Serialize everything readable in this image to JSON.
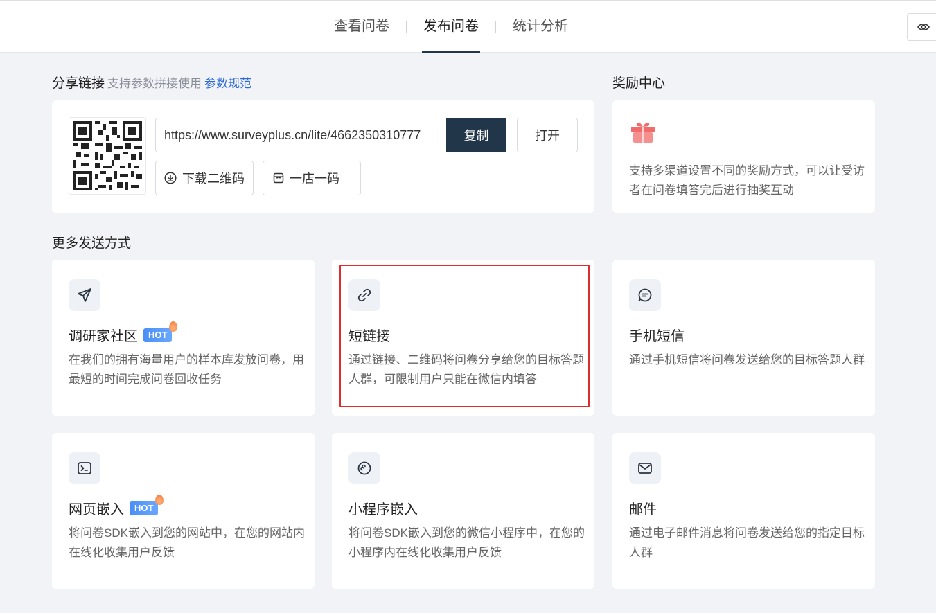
{
  "tabs": [
    {
      "label": "查看问卷",
      "active": false
    },
    {
      "label": "发布问卷",
      "active": true
    },
    {
      "label": "统计分析",
      "active": false
    }
  ],
  "share": {
    "title": "分享链接",
    "hint": "支持参数拼接使用",
    "spec_link": "参数规范",
    "url": "https://www.surveyplus.cn/lite/4662350310777",
    "copy_label": "复制",
    "open_label": "打开",
    "download_qr_label": "下载二维码",
    "store_code_label": "一店一码"
  },
  "reward": {
    "title": "奖励中心",
    "description": "支持多渠道设置不同的奖励方式，可以让受访者在问卷填答完后进行抽奖互动"
  },
  "more": {
    "title": "更多发送方式",
    "hot_label": "HOT",
    "methods": [
      {
        "title": "调研家社区",
        "hot": true,
        "icon": "send-icon",
        "description": "在我们的拥有海量用户的样本库发放问卷，用最短的时间完成问卷回收任务"
      },
      {
        "title": "短链接",
        "hot": false,
        "icon": "link-icon",
        "description": "通过链接、二维码将问卷分享给您的目标答题人群，可限制用户只能在微信内填答",
        "highlighted": true
      },
      {
        "title": "手机短信",
        "hot": false,
        "icon": "message-icon",
        "description": "通过手机短信将问卷发送给您的目标答题人群"
      },
      {
        "title": "网页嵌入",
        "hot": true,
        "icon": "terminal-icon",
        "description": "将问卷SDK嵌入到您的网站中，在您的网站内在线化收集用户反馈"
      },
      {
        "title": "小程序嵌入",
        "hot": false,
        "icon": "mini-program-icon",
        "description": "将问卷SDK嵌入到您的微信小程序中，在您的小程序内在线化收集用户反馈"
      },
      {
        "title": "邮件",
        "hot": false,
        "icon": "mail-icon",
        "description": "通过电子邮件消息将问卷发送给您的指定目标人群"
      }
    ]
  },
  "colors": {
    "primary": "#22364a",
    "link": "#2f6bd6",
    "highlight": "#e02c2c",
    "hot": "#4a8ff7"
  }
}
